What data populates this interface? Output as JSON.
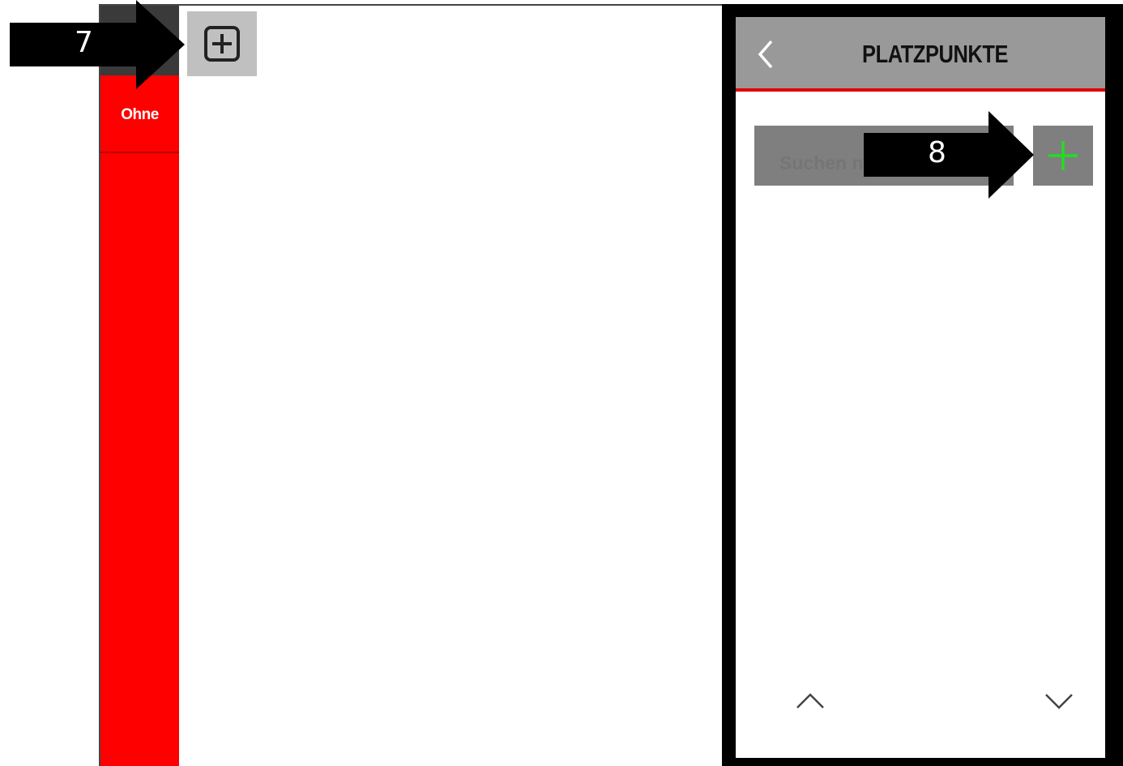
{
  "sidebar": {
    "items": [
      {
        "label": "Ohne"
      }
    ]
  },
  "toolbar": {
    "add_icon": "plus-square-icon"
  },
  "panel": {
    "title": "PLATZPUNKTE",
    "back_icon": "chevron-left-icon",
    "search": {
      "placeholder": "Suchen na"
    },
    "add_icon": "plus-icon",
    "scroll_up_icon": "chevron-up-icon",
    "scroll_down_icon": "chevron-down-icon"
  },
  "annotations": [
    {
      "label": "7"
    },
    {
      "label": "8"
    }
  ],
  "colors": {
    "sidebar": "#ff0000",
    "sidebar_top": "#3a3a3a",
    "header": "#999999",
    "header_accent": "#e00000",
    "button_gray": "#7f7f7f",
    "plus_green": "#22dd22",
    "tile_gray": "#c0c0c0"
  }
}
